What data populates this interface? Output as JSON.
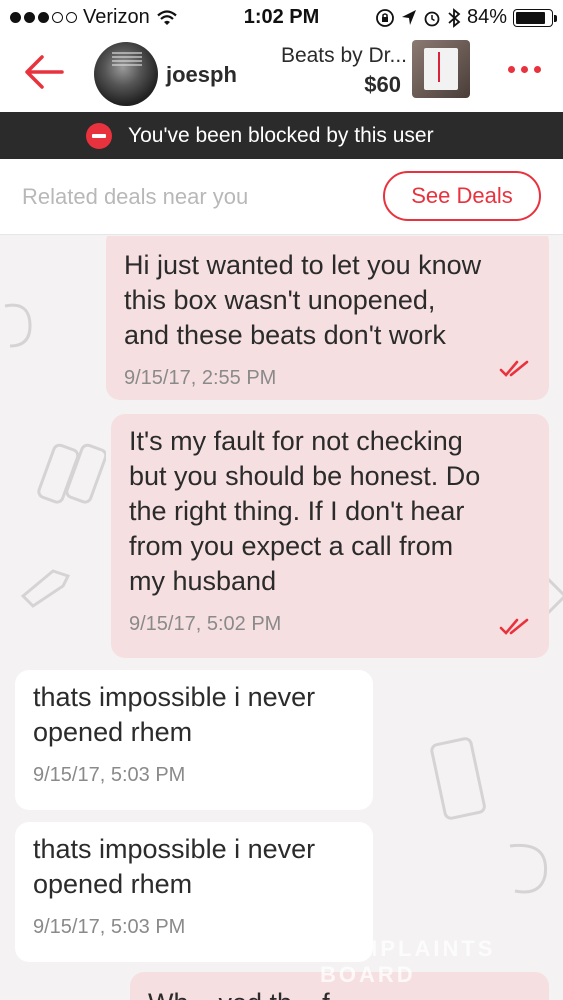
{
  "status_bar": {
    "carrier": "Verizon",
    "time": "1:02 PM",
    "battery": "84%",
    "battery_level": 0.84,
    "signal_bars": 3
  },
  "header": {
    "username": "joesph",
    "product_title": "Beats by Dr...",
    "product_price": "$60",
    "accent_color": "#e8323d"
  },
  "blocked_banner": {
    "text": "You've been blocked by this user"
  },
  "deals": {
    "placeholder": "Related deals near you",
    "button_label": "See Deals"
  },
  "messages": [
    {
      "direction": "outgoing",
      "text": "Hi just wanted to let you know\nthis box wasn't unopened,\nand these beats don't work",
      "timestamp": "9/15/17, 2:55 PM",
      "read": true
    },
    {
      "direction": "outgoing",
      "text": "It's my fault for not checking\nbut you should be honest. Do\nthe right thing. If I don't hear\nfrom you expect a call from\nmy husband",
      "timestamp": "9/15/17, 5:02 PM",
      "read": true
    },
    {
      "direction": "incoming",
      "text": "thats impossible i never\nopened rhem",
      "timestamp": "9/15/17, 5:03 PM"
    },
    {
      "direction": "incoming",
      "text": "thats impossible i never\nopened rhem",
      "timestamp": "9/15/17, 5:03 PM"
    },
    {
      "direction": "outgoing",
      "text": "Wh... ved th... f...",
      "timestamp": ""
    }
  ],
  "watermark": "COMPLAINTS BOARD"
}
